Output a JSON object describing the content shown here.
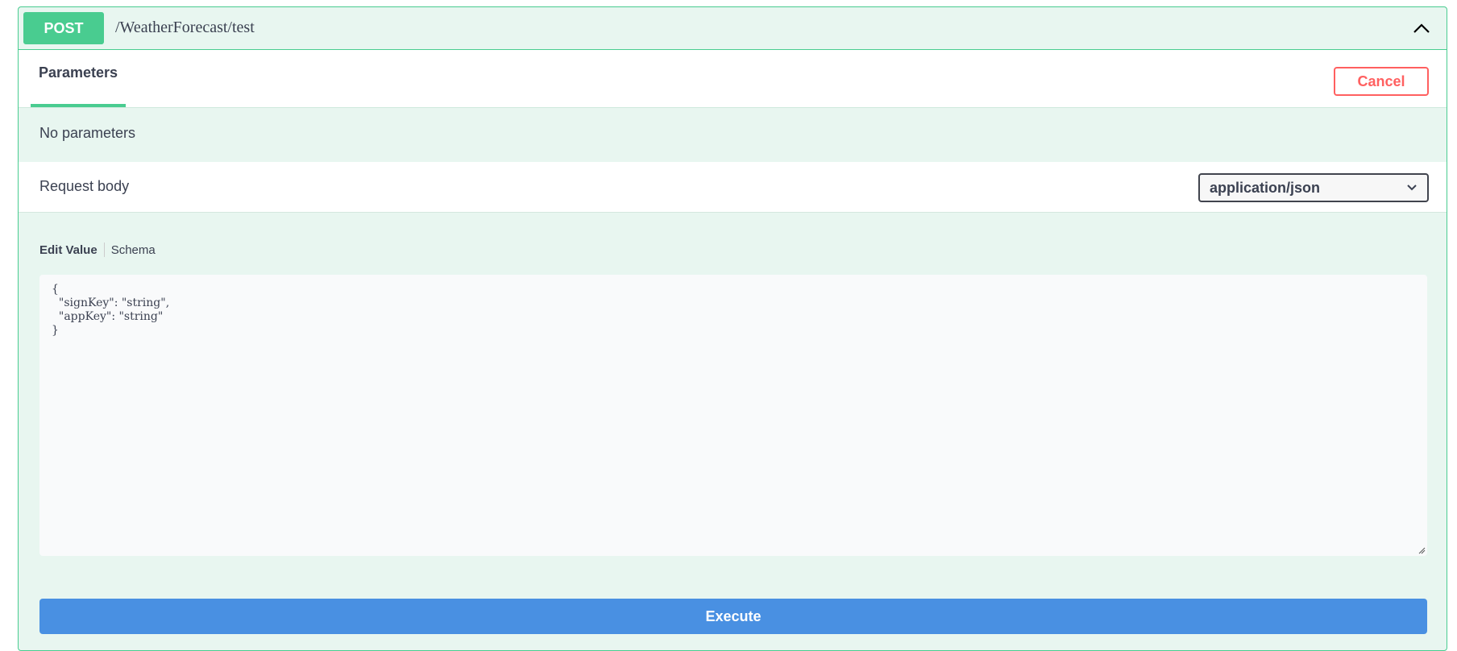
{
  "operation": {
    "method": "POST",
    "path": "/WeatherForecast/test"
  },
  "tabs": {
    "parameters_label": "Parameters",
    "cancel_label": "Cancel"
  },
  "parameters": {
    "empty_text": "No parameters"
  },
  "request_body": {
    "label": "Request body",
    "content_type": "application/json",
    "edit_value_tab": "Edit Value",
    "schema_tab": "Schema",
    "value": "{\n  \"signKey\": \"string\",\n  \"appKey\": \"string\"\n}"
  },
  "actions": {
    "execute_label": "Execute"
  },
  "colors": {
    "post_green": "#49cc90",
    "panel_bg": "#e8f6f0",
    "cancel_red": "#ff6060",
    "execute_blue": "#4990e2"
  },
  "icons": {
    "collapse": "chevron-up-icon",
    "select_arrow": "chevron-down-icon",
    "resize": "resize-grip-icon"
  }
}
